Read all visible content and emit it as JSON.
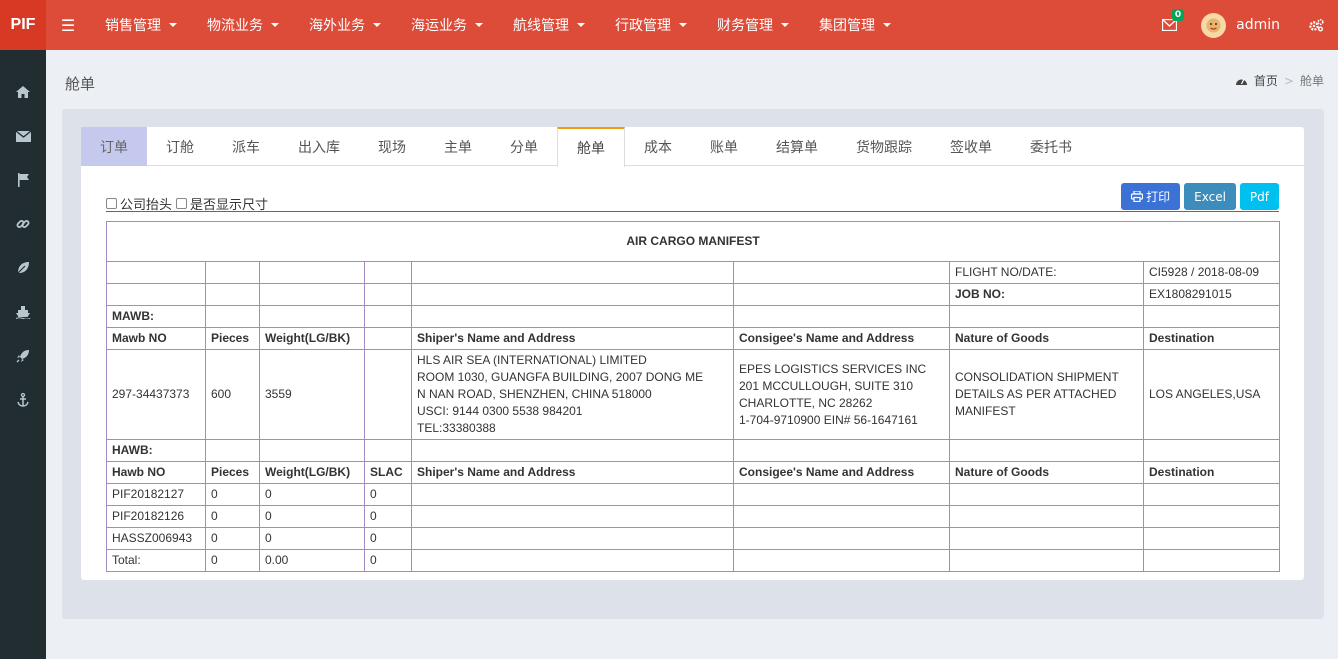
{
  "topbar": {
    "logo": "PIF",
    "menu": [
      "销售管理",
      "物流业务",
      "海外业务",
      "海运业务",
      "航线管理",
      "行政管理",
      "财务管理",
      "集团管理"
    ],
    "mail_count": "0",
    "user": "admin"
  },
  "sidebar": {
    "icons": [
      "home-icon",
      "mail-icon",
      "flag-icon",
      "link-icon",
      "leaf-icon",
      "ship-icon",
      "rocket-icon",
      "anchor-icon"
    ]
  },
  "header": {
    "title": "舱单",
    "breadcrumb": {
      "home": "首页",
      "current": "舱单"
    }
  },
  "tabs": [
    "订单",
    "订舱",
    "派车",
    "出入库",
    "现场",
    "主单",
    "分单",
    "舱单",
    "成本",
    "账单",
    "结算单",
    "货物跟踪",
    "签收单",
    "委托书"
  ],
  "options": {
    "company_header": "公司抬头",
    "show_size": "是否显示尺寸"
  },
  "buttons": {
    "print": "打印",
    "excel": "Excel",
    "pdf": "Pdf"
  },
  "manifest": {
    "title": "AIR CARGO MANIFEST",
    "flight_label": "FLIGHT NO/DATE:",
    "flight_value": "CI5928 / 2018-08-09",
    "job_label": "JOB NO:",
    "job_value": "EX1808291015",
    "mawb_label": "MAWB:",
    "mawb_headers": [
      "Mawb NO",
      "Pieces",
      "Weight(LG/BK)",
      "",
      "Shiper's Name and Address",
      "Consigee's Name and Address",
      "Nature of Goods",
      "Destination"
    ],
    "mawb_row": {
      "no": "297-34437373",
      "pieces": "600",
      "weight": "3559",
      "shipper": [
        "HLS AIR SEA (INTERNATIONAL) LIMITED",
        "ROOM 1030, GUANGFA BUILDING, 2007 DONG ME",
        "N NAN ROAD, SHENZHEN, CHINA 518000",
        "USCI: 9144 0300 5538 984201",
        "TEL:33380388"
      ],
      "consignee": [
        "EPES LOGISTICS SERVICES INC",
        "201 MCCULLOUGH, SUITE 310",
        "CHARLOTTE, NC 28262",
        "1-704-9710900 EIN# 56-1647161"
      ],
      "goods": [
        "CONSOLIDATION SHIPMENT",
        "DETAILS AS PER ATTACHED",
        "MANIFEST"
      ],
      "destination": "LOS ANGELES,USA"
    },
    "hawb_label": "HAWB:",
    "hawb_headers": [
      "Hawb NO",
      "Pieces",
      "Weight(LG/BK)",
      "SLAC",
      "Shiper's Name and Address",
      "Consigee's Name and Address",
      "Nature of Goods",
      "Destination"
    ],
    "hawb_rows": [
      [
        "PIF20182127",
        "0",
        "0",
        "0"
      ],
      [
        "PIF20182126",
        "0",
        "0",
        "0"
      ],
      [
        "HASSZ006943",
        "0",
        "0",
        "0"
      ],
      [
        "Total:",
        "0",
        "0.00",
        "0"
      ]
    ]
  }
}
